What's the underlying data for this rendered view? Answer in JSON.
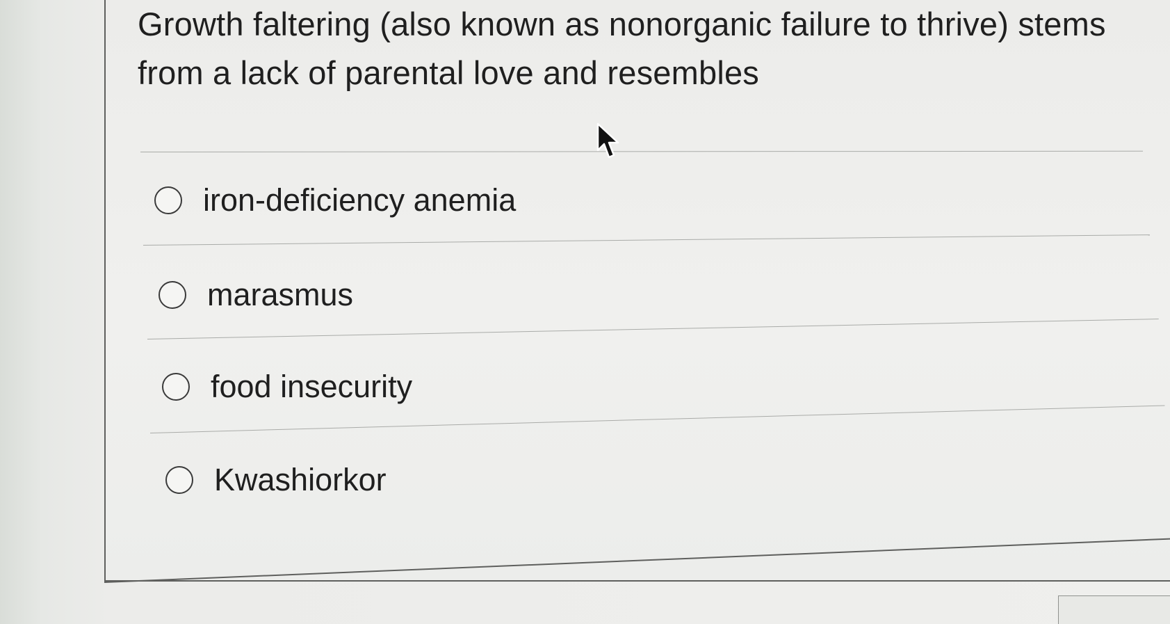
{
  "question": {
    "text": "Growth faltering (also known as nonorganic failure to thrive) stems from a lack of parental love and resembles"
  },
  "options": [
    {
      "label": "iron-deficiency anemia",
      "selected": false
    },
    {
      "label": "marasmus",
      "selected": false
    },
    {
      "label": "food insecurity",
      "selected": false
    },
    {
      "label": "Kwashiorkor",
      "selected": false
    }
  ],
  "colors": {
    "text": "#1f1f1f",
    "radio_border": "#3a3a3a",
    "divider": "#a9aba8",
    "card_border": "#5e5f5d"
  },
  "icons": {
    "cursor": "mouse-pointer-arrow-icon",
    "radio": "radio-button-icon"
  }
}
